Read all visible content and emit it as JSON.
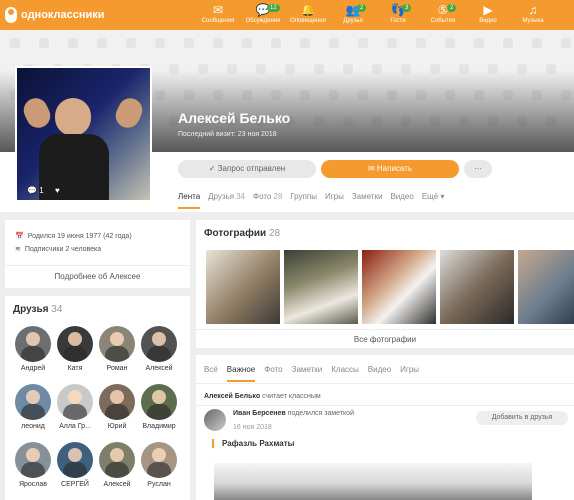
{
  "brand": {
    "name": "одноклассники"
  },
  "nav": [
    {
      "label": "Сообщения",
      "icon": "envelope-icon",
      "glyph": "✉",
      "badge": ""
    },
    {
      "label": "Обсуждения",
      "icon": "chat-icon",
      "glyph": "💬",
      "badge": "12"
    },
    {
      "label": "Оповещения",
      "icon": "bell-icon",
      "glyph": "🔔",
      "badge": ""
    },
    {
      "label": "Друзья",
      "icon": "friends-icon",
      "glyph": "👥",
      "badge": "2"
    },
    {
      "label": "Гости",
      "icon": "footprints-icon",
      "glyph": "👣",
      "badge": "3"
    },
    {
      "label": "События",
      "icon": "events-icon",
      "glyph": "⑤",
      "badge": "2"
    },
    {
      "label": "Видео",
      "icon": "video-icon",
      "glyph": "▶",
      "badge": ""
    },
    {
      "label": "Музыка",
      "icon": "music-icon",
      "glyph": "♫",
      "badge": ""
    }
  ],
  "profile": {
    "name": "Алексей Белько",
    "last_visit": "Последний визит: 23 ноя 2018",
    "avatar_comments": "1",
    "request_sent": "Запрос отправлен",
    "write": "Написать",
    "more": "···"
  },
  "profile_tabs": [
    {
      "label": "Лента"
    },
    {
      "label": "Друзья",
      "count": "34"
    },
    {
      "label": "Фото",
      "count": "28"
    },
    {
      "label": "Группы"
    },
    {
      "label": "Игры"
    },
    {
      "label": "Заметки"
    },
    {
      "label": "Видео"
    },
    {
      "label": "Ещё ▾"
    }
  ],
  "info": {
    "birth": "Родился 19 июня 1977 (42 года)",
    "subscribers": "Подписчики 2 человека",
    "more_about": "Подробнее об Алексее"
  },
  "friends": {
    "title": "Друзья",
    "count": "34",
    "list": [
      "Андрей",
      "Катя",
      "Роман",
      "Алексей",
      "леонид",
      "Алла Гр...",
      "Юрий",
      "Владимир",
      "Ярослав",
      "СЕРГЕЙ",
      "Алексей",
      "Руслан"
    ]
  },
  "photos": {
    "title": "Фотографии",
    "count": "28",
    "all": "Все фотографии"
  },
  "feed": {
    "tabs": [
      "Всё",
      "Важное",
      "Фото",
      "Заметки",
      "Классы",
      "Видео",
      "Игры"
    ],
    "header_name": "Алексей Белько",
    "header_text": "считает классным",
    "post_author": "Иван Берсенев",
    "post_action": "поделился заметкой",
    "post_date": "16 ноя 2018",
    "add_friend": "Добавить в друзья",
    "note_title": "Рафазль Рахматы"
  },
  "colors": {
    "accent": "#f59a2e",
    "badge": "#4aa53d"
  }
}
